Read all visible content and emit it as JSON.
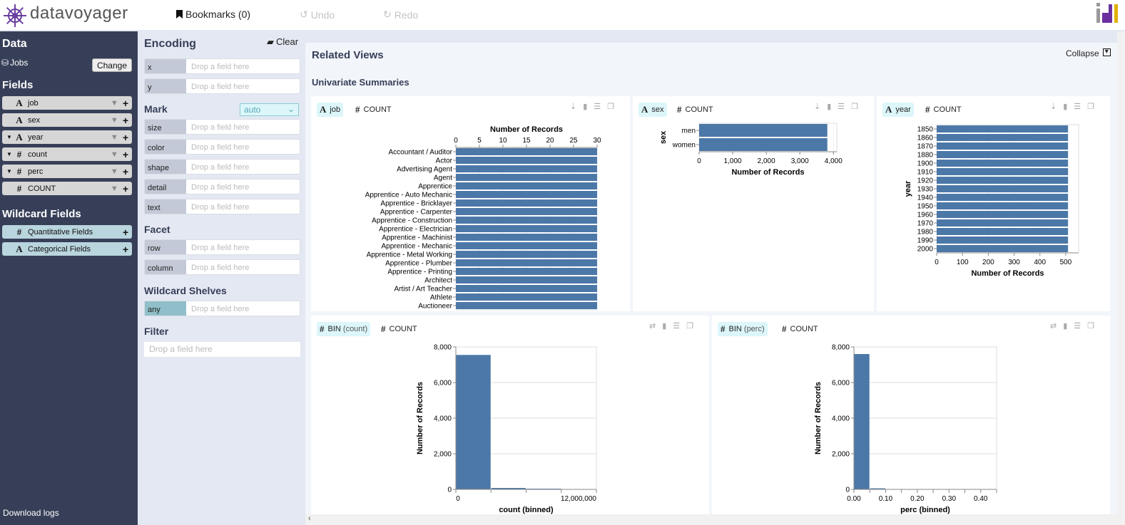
{
  "header": {
    "logo": "datavoyager",
    "bookmarks": "Bookmarks (0)",
    "undo": "Undo",
    "redo": "Redo"
  },
  "sidebar": {
    "data_title": "Data",
    "dataset": "Jobs",
    "change": "Change",
    "fields_title": "Fields",
    "fields": [
      {
        "name": "job",
        "type": "A",
        "caret": false
      },
      {
        "name": "sex",
        "type": "A",
        "caret": false
      },
      {
        "name": "year",
        "type": "A",
        "caret": true
      },
      {
        "name": "count",
        "type": "#",
        "caret": true
      },
      {
        "name": "perc",
        "type": "#",
        "caret": true
      },
      {
        "name": "COUNT",
        "type": "#",
        "caret": false
      }
    ],
    "wildcard_title": "Wildcard Fields",
    "wildcards": [
      {
        "name": "Quantitative Fields",
        "type": "#"
      },
      {
        "name": "Categorical Fields",
        "type": "A"
      }
    ],
    "download": "Download logs"
  },
  "encoding": {
    "title": "Encoding",
    "clear": "Clear",
    "placeholder": "Drop a field here",
    "channels": [
      "x",
      "y"
    ],
    "mark_title": "Mark",
    "mark_value": "auto",
    "mark_channels": [
      "size",
      "color",
      "shape",
      "detail",
      "text"
    ],
    "facet_title": "Facet",
    "facet_channels": [
      "row",
      "column"
    ],
    "wildcard_title": "Wildcard Shelves",
    "wildcard_channels": [
      "any"
    ],
    "filter_title": "Filter"
  },
  "main": {
    "title": "Related Views",
    "collapse": "Collapse",
    "section": "Univariate Summaries",
    "cards": [
      {
        "chips": [
          {
            "type": "A",
            "label": "job"
          },
          {
            "type": "#",
            "label": "COUNT"
          }
        ]
      },
      {
        "chips": [
          {
            "type": "A",
            "label": "sex"
          },
          {
            "type": "#",
            "label": "COUNT"
          }
        ]
      },
      {
        "chips": [
          {
            "type": "A",
            "label": "year"
          },
          {
            "type": "#",
            "label": "COUNT"
          }
        ]
      },
      {
        "chips": [
          {
            "type": "#",
            "label": "BIN",
            "sub": "(count)"
          },
          {
            "type": "#",
            "label": "COUNT"
          }
        ]
      },
      {
        "chips": [
          {
            "type": "#",
            "label": "BIN",
            "sub": "(perc)"
          },
          {
            "type": "#",
            "label": "COUNT"
          }
        ]
      }
    ]
  },
  "colors": {
    "bar": "#4c78a8",
    "sidebar": "#373f58",
    "chip": "#dcf6fa"
  },
  "chart_data": [
    {
      "type": "bar",
      "orientation": "horizontal",
      "xlabel": "Number of Records",
      "ylabel": "",
      "xlim": [
        0,
        30
      ],
      "xticks": [
        0,
        5,
        10,
        15,
        20,
        25,
        30
      ],
      "axis": "top",
      "categories": [
        "Accountant / Auditor",
        "Actor",
        "Advertising Agent",
        "Agent",
        "Apprentice",
        "Apprentice - Auto Mechanic",
        "Apprentice - Bricklayer",
        "Apprentice - Carpenter",
        "Apprentice - Construction",
        "Apprentice - Electrician",
        "Apprentice - Machinist",
        "Apprentice - Mechanic",
        "Apprentice - Metal Working",
        "Apprentice - Plumber",
        "Apprentice - Printing",
        "Architect",
        "Artist / Art Teacher",
        "Athlete",
        "Auctioneer"
      ],
      "values": [
        30,
        30,
        30,
        30,
        30,
        30,
        30,
        30,
        30,
        30,
        30,
        30,
        30,
        30,
        30,
        30,
        30,
        30,
        30
      ]
    },
    {
      "type": "bar",
      "orientation": "horizontal",
      "xlabel": "Number of Records",
      "ylabel": "sex",
      "xlim": [
        0,
        4100
      ],
      "xticks": [
        0,
        1000,
        2000,
        3000,
        4000
      ],
      "tick_labels": [
        "0",
        "1,000",
        "2,000",
        "3,000",
        "4,000"
      ],
      "axis": "bottom",
      "categories": [
        "men",
        "women"
      ],
      "values": [
        3818,
        3818
      ]
    },
    {
      "type": "bar",
      "orientation": "horizontal",
      "xlabel": "Number of Records",
      "ylabel": "year",
      "xlim": [
        0,
        550
      ],
      "xticks": [
        0,
        100,
        200,
        300,
        400,
        500
      ],
      "axis": "bottom",
      "categories": [
        "1850",
        "1860",
        "1870",
        "1880",
        "1900",
        "1910",
        "1920",
        "1930",
        "1940",
        "1950",
        "1960",
        "1970",
        "1980",
        "1990",
        "2000"
      ],
      "values": [
        509,
        509,
        509,
        509,
        509,
        509,
        509,
        509,
        509,
        509,
        509,
        509,
        509,
        509,
        509
      ]
    },
    {
      "type": "bar",
      "histogram": true,
      "xlabel": "count (binned)",
      "ylabel": "Number of Records",
      "xlim": [
        0,
        12000000
      ],
      "ylim": [
        0,
        8000
      ],
      "yticks": [
        0,
        2000,
        4000,
        6000,
        8000
      ],
      "ytick_labels": [
        "0",
        "2,000",
        "4,000",
        "6,000",
        "8,000"
      ],
      "xticks": [
        0,
        3000000,
        6000000,
        9000000,
        12000000
      ],
      "xtick_labels": [
        "0",
        "",
        "",
        "",
        "12,000,000"
      ],
      "bins": [
        [
          0,
          3000000
        ],
        [
          3000000,
          6000000
        ],
        [
          6000000,
          9000000
        ],
        [
          9000000,
          12000000
        ]
      ],
      "values": [
        7550,
        80,
        40,
        15
      ]
    },
    {
      "type": "bar",
      "histogram": true,
      "xlabel": "perc (binned)",
      "ylabel": "Number of Records",
      "xlim": [
        0,
        0.45
      ],
      "ylim": [
        0,
        8000
      ],
      "yticks": [
        0,
        2000,
        4000,
        6000,
        8000
      ],
      "ytick_labels": [
        "0",
        "2,000",
        "4,000",
        "6,000",
        "8,000"
      ],
      "xticks": [
        0,
        0.05,
        0.1,
        0.15,
        0.2,
        0.25,
        0.3,
        0.35,
        0.4,
        0.45
      ],
      "xtick_labels": [
        "0.00",
        "",
        "0.10",
        "",
        "0.20",
        "",
        "0.30",
        "",
        "0.40",
        ""
      ],
      "bins": [
        [
          0,
          0.05
        ],
        [
          0.05,
          0.1
        ],
        [
          0.1,
          0.15
        ]
      ],
      "values": [
        7600,
        60,
        20
      ]
    }
  ]
}
